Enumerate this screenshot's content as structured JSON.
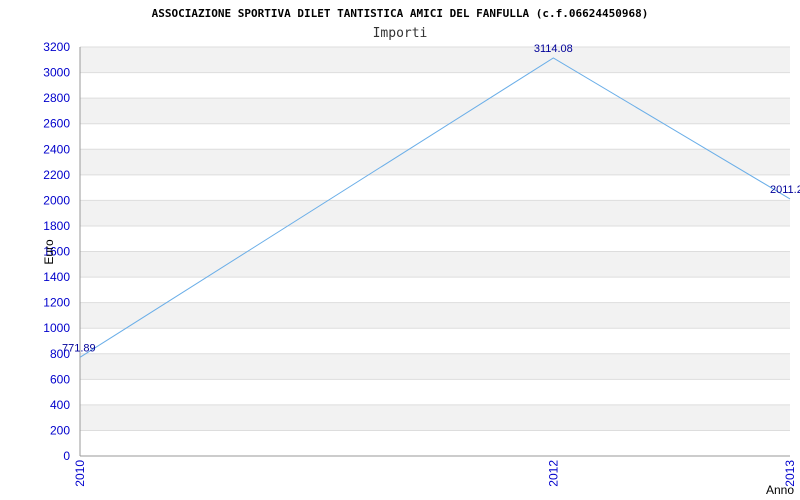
{
  "chart_data": {
    "type": "line",
    "title": "ASSOCIAZIONE SPORTIVA DILET TANTISTICA AMICI DEL FANFULLA (c.f.06624450968)",
    "subtitle": "Importi",
    "xlabel": "Anno",
    "ylabel": "Euro",
    "x": [
      "2010",
      "2012",
      "2013"
    ],
    "series": [
      {
        "name": "",
        "values": [
          771.89,
          3114.08,
          2011.2
        ],
        "labels": [
          "771.89",
          "3114.08",
          "2011.2"
        ]
      }
    ],
    "ylim": [
      0,
      3200
    ],
    "yticks": [
      "0",
      "200",
      "400",
      "600",
      "800",
      "1000",
      "1200",
      "1400",
      "1600",
      "1800",
      "2000",
      "2200",
      "2400",
      "2600",
      "2800",
      "3000",
      "3200"
    ],
    "grid": true,
    "colors": {
      "line": "#6aaee8",
      "band": "#f2f2f2",
      "tick": "#0000cc",
      "label": "#000099"
    }
  }
}
